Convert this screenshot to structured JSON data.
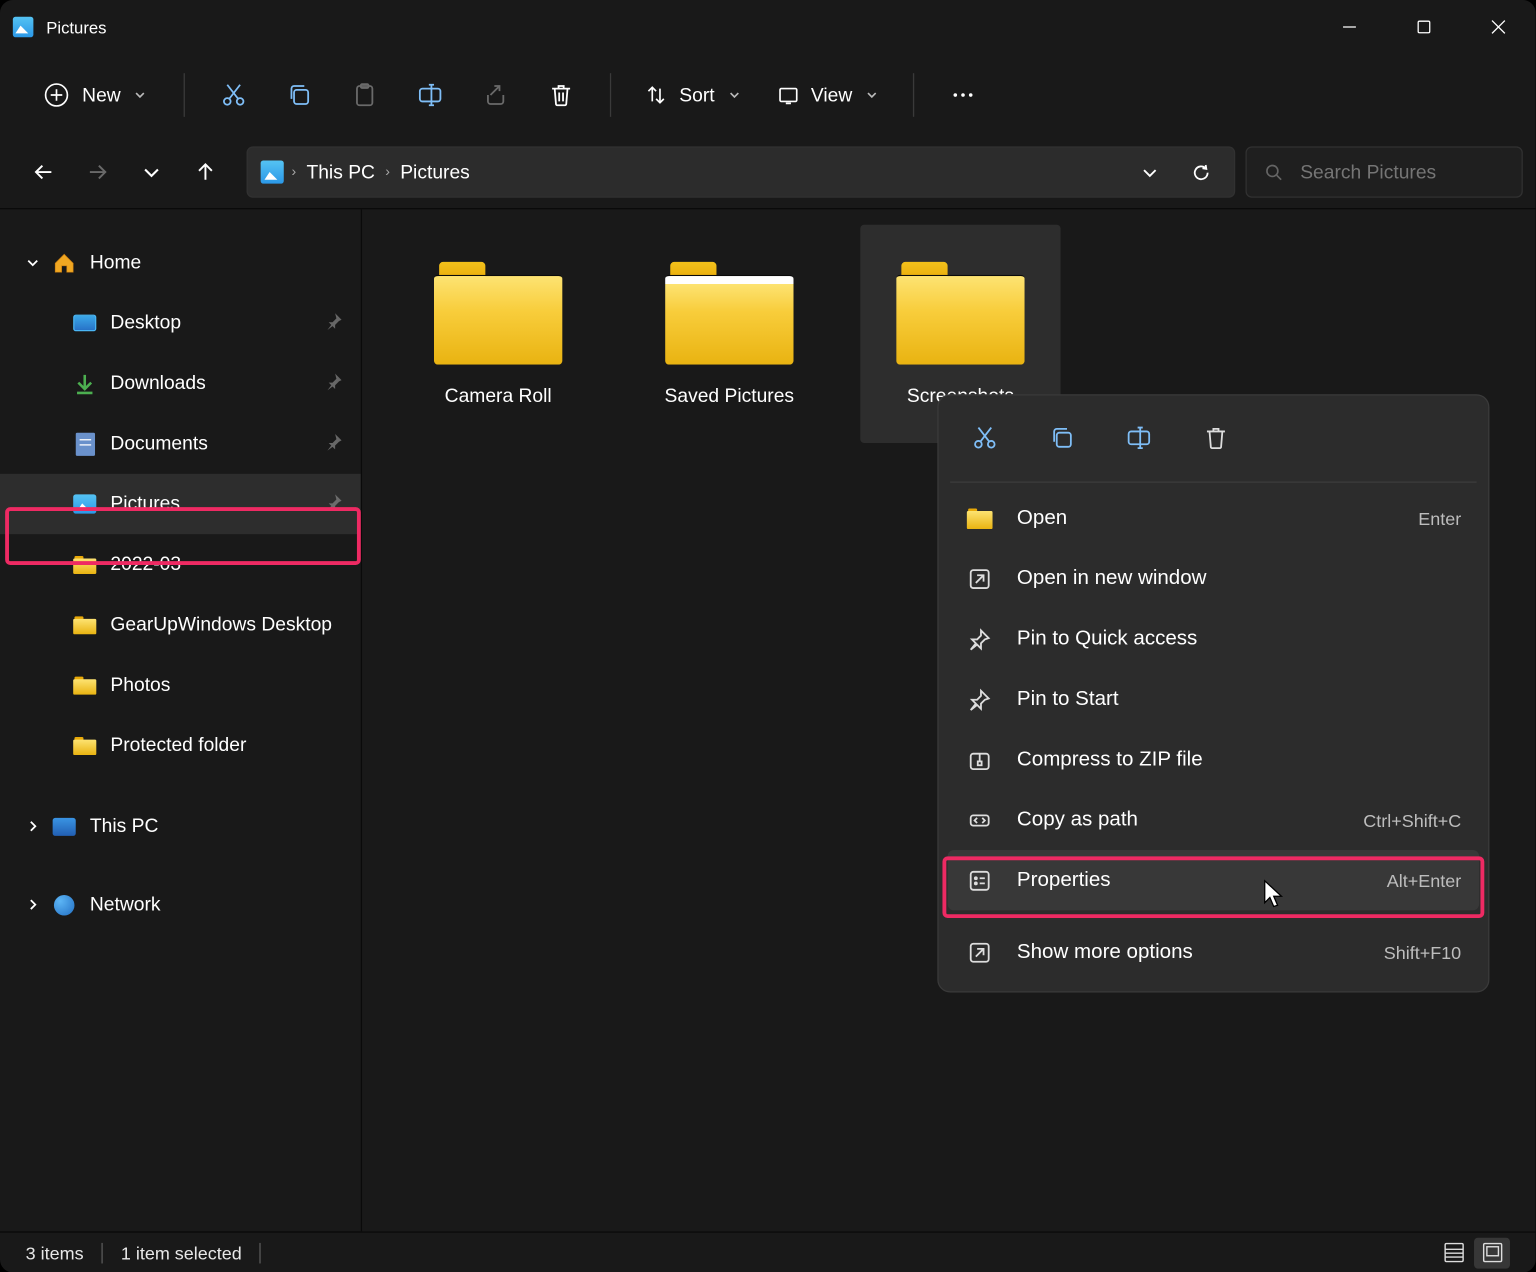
{
  "title": "Pictures",
  "toolbar": {
    "new": "New",
    "sort": "Sort",
    "view": "View"
  },
  "breadcrumb": {
    "a": "This PC",
    "b": "Pictures"
  },
  "search": {
    "placeholder": "Search Pictures"
  },
  "sidebar": {
    "home": "Home",
    "desktop": "Desktop",
    "downloads": "Downloads",
    "documents": "Documents",
    "pictures": "Pictures",
    "y2022": "2022-03",
    "gear": "GearUpWindows Desktop",
    "photos": "Photos",
    "protected": "Protected folder",
    "thispc": "This PC",
    "network": "Network"
  },
  "folders": {
    "a": "Camera Roll",
    "b": "Saved Pictures",
    "c": "Screenshots"
  },
  "ctx": {
    "open": "Open",
    "open_sc": "Enter",
    "newwin": "Open in new window",
    "quick": "Pin to Quick access",
    "start": "Pin to Start",
    "zip": "Compress to ZIP file",
    "copypath": "Copy as path",
    "copypath_sc": "Ctrl+Shift+C",
    "props": "Properties",
    "props_sc": "Alt+Enter",
    "more": "Show more options",
    "more_sc": "Shift+F10"
  },
  "status": {
    "items": "3 items",
    "selected": "1 item selected"
  }
}
